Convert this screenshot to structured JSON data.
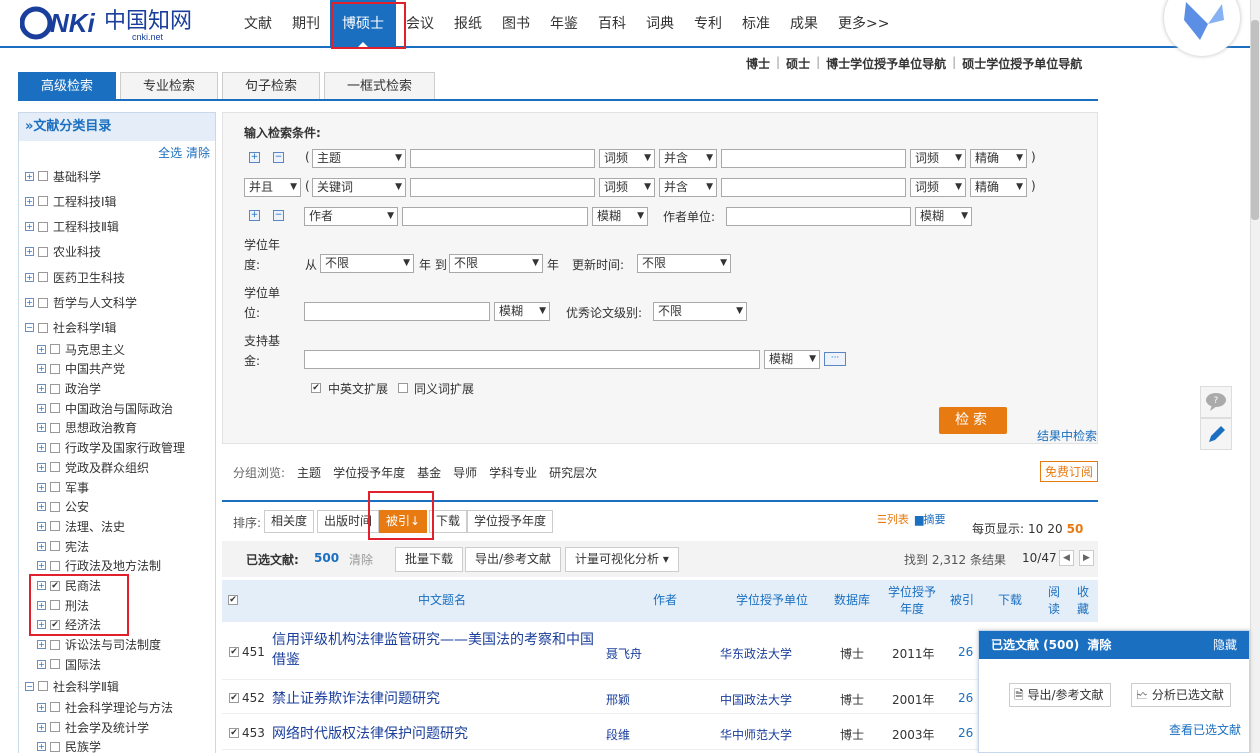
{
  "nav": {
    "items": [
      "文献",
      "期刊",
      "博硕士",
      "会议",
      "报纸",
      "图书",
      "年鉴",
      "百科",
      "词典",
      "专利",
      "标准",
      "成果",
      "更多>>"
    ],
    "active": "博硕士"
  },
  "logo": {
    "text": "cnki.net"
  },
  "subnav": {
    "items": [
      "博士",
      "硕士",
      "博士学位授予单位导航",
      "硕士学位授予单位导航"
    ]
  },
  "tabs": [
    "高级检索",
    "专业检索",
    "句子检索",
    "一框式检索"
  ],
  "sidebar": {
    "title": "»文献分类目录",
    "select_all": "全选",
    "clear": "清除",
    "top_categories": [
      "基础科学",
      "工程科技Ⅰ辑",
      "工程科技Ⅱ辑",
      "农业科技",
      "医药卫生科技",
      "哲学与人文科学",
      "社会科学Ⅰ辑"
    ],
    "sub_categories": [
      {
        "label": "马克思主义",
        "checked": false
      },
      {
        "label": "中国共产党",
        "checked": false
      },
      {
        "label": "政治学",
        "checked": false
      },
      {
        "label": "中国政治与国际政治",
        "checked": false
      },
      {
        "label": "思想政治教育",
        "checked": false
      },
      {
        "label": "行政学及国家行政管理",
        "checked": false
      },
      {
        "label": "党政及群众组织",
        "checked": false
      },
      {
        "label": "军事",
        "checked": false
      },
      {
        "label": "公安",
        "checked": false
      },
      {
        "label": "法理、法史",
        "checked": false
      },
      {
        "label": "宪法",
        "checked": false
      },
      {
        "label": "行政法及地方法制",
        "checked": false
      },
      {
        "label": "民商法",
        "checked": true
      },
      {
        "label": "刑法",
        "checked": false
      },
      {
        "label": "经济法",
        "checked": true
      },
      {
        "label": "诉讼法与司法制度",
        "checked": false
      },
      {
        "label": "国际法",
        "checked": false
      }
    ],
    "after_categories": [
      "社会科学Ⅱ辑"
    ],
    "after_sub": [
      {
        "label": "社会科学理论与方法",
        "checked": false
      },
      {
        "label": "社会学及统计学",
        "checked": false
      },
      {
        "label": "民族学",
        "checked": false
      }
    ]
  },
  "form": {
    "title": "输入检索条件:",
    "row1": {
      "field": "主题",
      "freq1": "词频",
      "op": "并含",
      "freq2": "词频",
      "match": "精确"
    },
    "row2": {
      "logic": "并且",
      "field": "关键词",
      "freq1": "词频",
      "op": "并含",
      "freq2": "词频",
      "match": "精确"
    },
    "row3": {
      "field": "作者",
      "match": "模糊",
      "unit_label": "作者单位:",
      "unit_match": "模糊"
    },
    "degree_year": {
      "label1": "学位年",
      "label2": "度:",
      "from": "从",
      "from_val": "不限",
      "year_to": "年 到",
      "to_val": "不限",
      "year": "年",
      "update_label": "更新时间:",
      "update_val": "不限"
    },
    "degree_unit": {
      "label1": "学位单",
      "label2": "位:",
      "match": "模糊",
      "excellent_label": "优秀论文级别:",
      "excellent_val": "不限"
    },
    "fund": {
      "label1": "支持基",
      "label2": "金:",
      "match": "模糊",
      "more": "···"
    },
    "ext1": "中英文扩展",
    "ext1_checked": true,
    "ext2": "同义词扩展",
    "ext2_checked": false,
    "search_btn": "检索",
    "result_search": "结果中检索"
  },
  "group": {
    "label": "分组浏览:",
    "items": [
      "主题",
      "学位授予年度",
      "基金",
      "导师",
      "学科专业",
      "研究层次"
    ],
    "free_sub": "免费订阅"
  },
  "sort": {
    "label": "排序:",
    "items": [
      "相关度",
      "出版时间",
      "被引↓",
      "下载",
      "学位授予年度"
    ],
    "active": "被引↓",
    "view_list": "☰列表",
    "view_abs": "▆摘要",
    "perpage_label": "每页显示:",
    "perpage": [
      "10",
      "20",
      "50"
    ],
    "perpage_current": "50"
  },
  "selbar": {
    "label": "已选文献:",
    "count": "500",
    "clear": "清除",
    "batch_download": "批量下载",
    "export": "导出/参考文献",
    "visual": "计量可视化分析 ▾",
    "found": "找到 2,312 条结果",
    "page": "10/47"
  },
  "table": {
    "headers": {
      "title": "中文题名",
      "author": "作者",
      "unit": "学位授予单位",
      "db": "数据库",
      "year1": "学位授予",
      "year2": "年度",
      "cited": "被引",
      "download": "下载",
      "read1": "阅",
      "read2": "读",
      "fav1": "收",
      "fav2": "藏"
    },
    "rows": [
      {
        "num": "451",
        "title": "信用评级机构法律监管研究——美国法的考察和中国借鉴",
        "author": "聂飞舟",
        "unit": "华东政法大学",
        "db": "博士",
        "year": "2011年",
        "cited": "26"
      },
      {
        "num": "452",
        "title": "禁止证券欺诈法律问题研究",
        "author": "邢颖",
        "unit": "中国政法大学",
        "db": "博士",
        "year": "2001年",
        "cited": "26"
      },
      {
        "num": "453",
        "title": "网络时代版权法律保护问题研究",
        "author": "段维",
        "unit": "华中师范大学",
        "db": "博士",
        "year": "2003年",
        "cited": "26"
      }
    ]
  },
  "selpanel": {
    "title": "已选文献 (500)",
    "clear": "清除",
    "hide": "隐藏",
    "export": "导出/参考文献",
    "analyze": "分析已选文献",
    "view": "查看已选文献"
  },
  "colors": {
    "brand": "#1a6fc0",
    "accent": "#e87a12",
    "highlight": "#e0212c"
  }
}
